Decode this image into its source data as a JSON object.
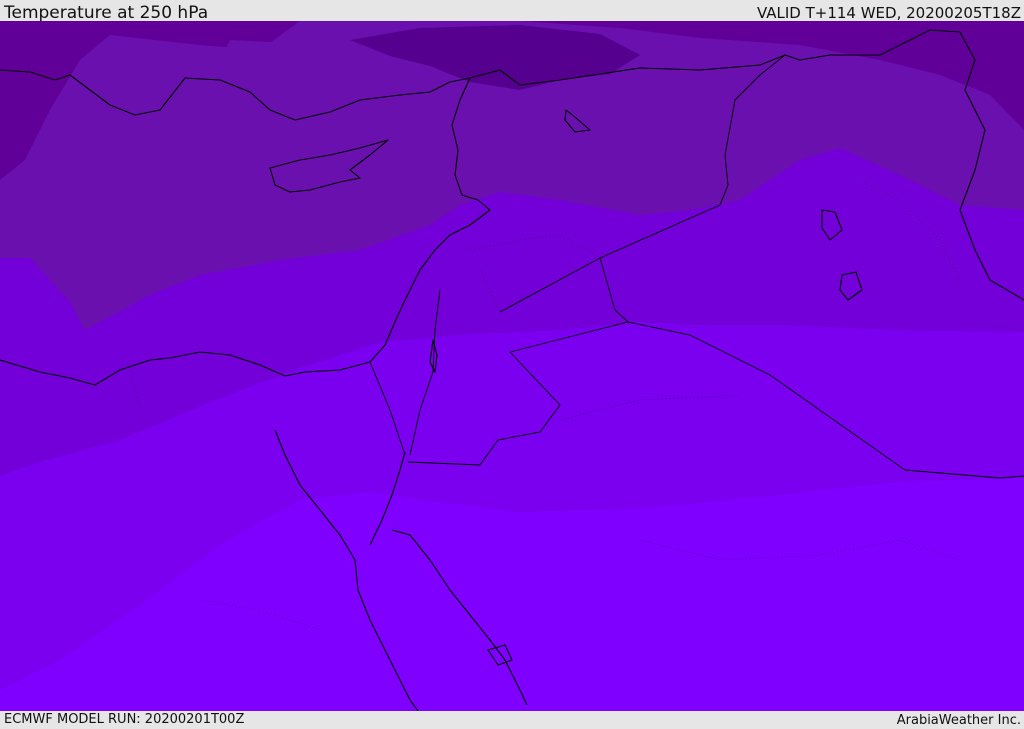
{
  "header": {
    "title": "Temperature at 250 hPa",
    "valid": "VALID T+114 WED, 20200205T18Z"
  },
  "footer": {
    "model_run": "ECMWF MODEL RUN: 20200201T00Z",
    "credit": "ArabiaWeather Inc."
  },
  "map": {
    "colors": {
      "band_coldest": "#55008f",
      "band_cold": "#600099",
      "band_mid": "#6a10ae",
      "band_warm": "#7300d9",
      "band_warmer": "#7a00ef",
      "band_warmest": "#7f00ff",
      "coastline": "#000000"
    }
  }
}
